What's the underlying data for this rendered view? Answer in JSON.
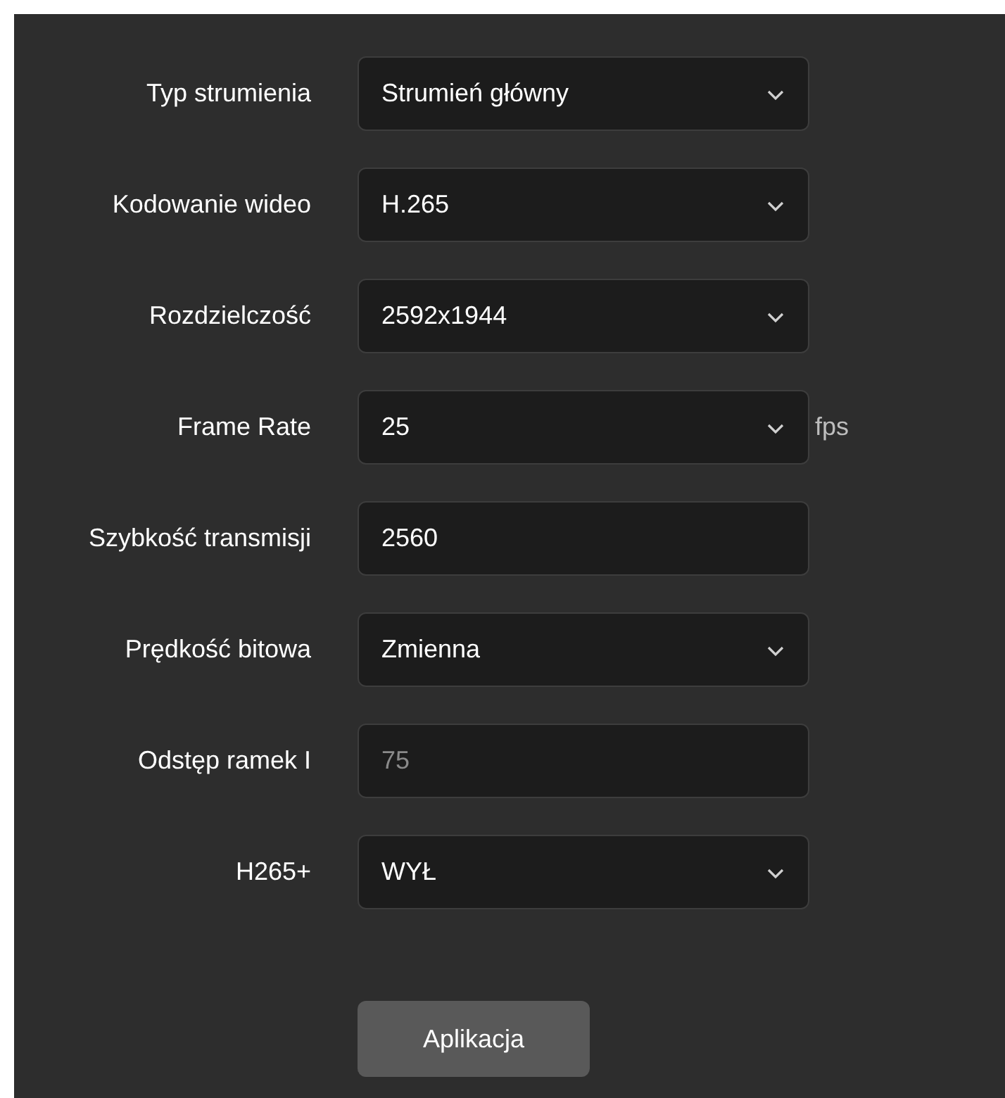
{
  "fields": [
    {
      "label": "Typ strumienia",
      "kind": "select",
      "value": "Strumień główny",
      "disabled": false
    },
    {
      "label": "Kodowanie wideo",
      "kind": "select",
      "value": "H.265",
      "disabled": false
    },
    {
      "label": "Rozdzielczość",
      "kind": "select",
      "value": "2592x1944",
      "disabled": false
    },
    {
      "label": "Frame Rate",
      "kind": "select",
      "value": "25",
      "unit": "fps",
      "disabled": false
    },
    {
      "label": "Szybkość transmisji",
      "kind": "input",
      "value": "2560",
      "disabled": false
    },
    {
      "label": "Prędkość bitowa",
      "kind": "select",
      "value": "Zmienna",
      "disabled": false
    },
    {
      "label": "Odstęp ramek I",
      "kind": "input",
      "value": "75",
      "disabled": true
    },
    {
      "label": "H265+",
      "kind": "select",
      "value": "WYŁ",
      "disabled": false
    }
  ],
  "apply_button": "Aplikacja"
}
